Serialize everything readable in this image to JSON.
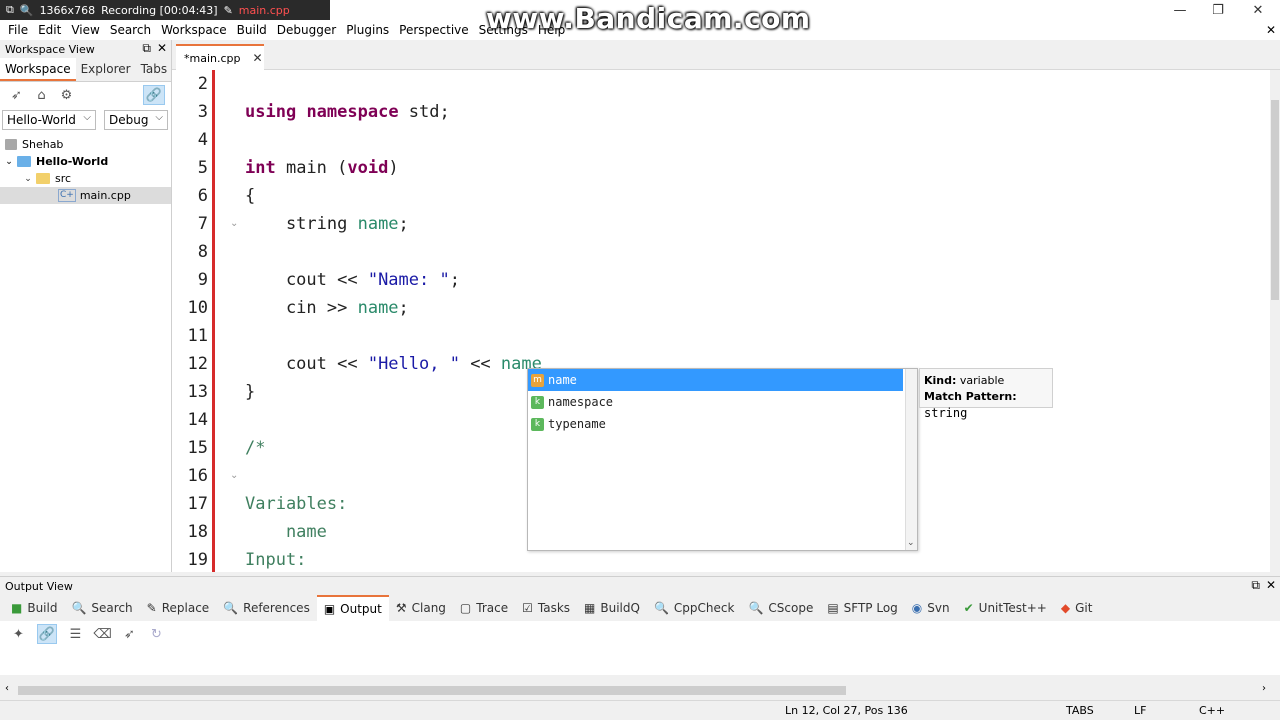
{
  "titlebar": {
    "recording_size": "1366x768",
    "recording_label": "Recording [00:04:43]",
    "recording_file": "main.cpp",
    "watermark": "www.Bandicam.com",
    "minimize": "—",
    "restore": "❐",
    "close": "✕"
  },
  "menu": {
    "items": [
      "File",
      "Edit",
      "View",
      "Search",
      "Workspace",
      "Build",
      "Debugger",
      "Plugins",
      "Perspective",
      "Settings",
      "Help"
    ]
  },
  "workspace": {
    "title": "Workspace View",
    "tabs": [
      "Workspace",
      "Explorer",
      "Tabs"
    ],
    "project_select": "Hello-World",
    "config_select": "Debug",
    "tree": {
      "root": "Shehab",
      "project": "Hello-World",
      "folder": "src",
      "file": "main.cpp"
    }
  },
  "editor": {
    "tab_label": "*main.cpp",
    "lines": [
      {
        "num": "2",
        "text": ""
      },
      {
        "num": "3",
        "text": "using namespace std;"
      },
      {
        "num": "4",
        "text": ""
      },
      {
        "num": "5",
        "text": "int main (void)"
      },
      {
        "num": "6",
        "text": "{"
      },
      {
        "num": "7",
        "text": "    string name;"
      },
      {
        "num": "8",
        "text": ""
      },
      {
        "num": "9",
        "text": "    cout << \"Name: \";"
      },
      {
        "num": "10",
        "text": "    cin >> name;"
      },
      {
        "num": "11",
        "text": ""
      },
      {
        "num": "12",
        "text": "    cout << \"Hello, \" << name"
      },
      {
        "num": "13",
        "text": "}"
      },
      {
        "num": "14",
        "text": ""
      },
      {
        "num": "15",
        "text": "/*"
      },
      {
        "num": "16",
        "text": ""
      },
      {
        "num": "17",
        "text": "Variables:"
      },
      {
        "num": "18",
        "text": "    name"
      },
      {
        "num": "19",
        "text": "Input:"
      }
    ]
  },
  "autocomplete": {
    "items": [
      {
        "badge": "m",
        "label": "name"
      },
      {
        "badge": "k",
        "label": "namespace"
      },
      {
        "badge": "k",
        "label": "typename"
      }
    ],
    "tip_kind_label": "Kind:",
    "tip_kind_value": "variable",
    "tip_match_label": "Match Pattern:",
    "tip_match_value": "string"
  },
  "output": {
    "title": "Output View",
    "tabs": [
      "Build",
      "Search",
      "Replace",
      "References",
      "Output",
      "Clang",
      "Trace",
      "Tasks",
      "BuildQ",
      "CppCheck",
      "CScope",
      "SFTP Log",
      "Svn",
      "UnitTest++",
      "Git"
    ]
  },
  "status": {
    "position": "Ln 12, Col 27, Pos 136",
    "indent": "TABS",
    "eol": "LF",
    "lang": "C++"
  },
  "colors": {
    "accent": "#e8743b",
    "selection": "#3399ff",
    "keyword": "#7f0055",
    "string": "#1a1aa6",
    "variable": "#2a8a6a"
  }
}
